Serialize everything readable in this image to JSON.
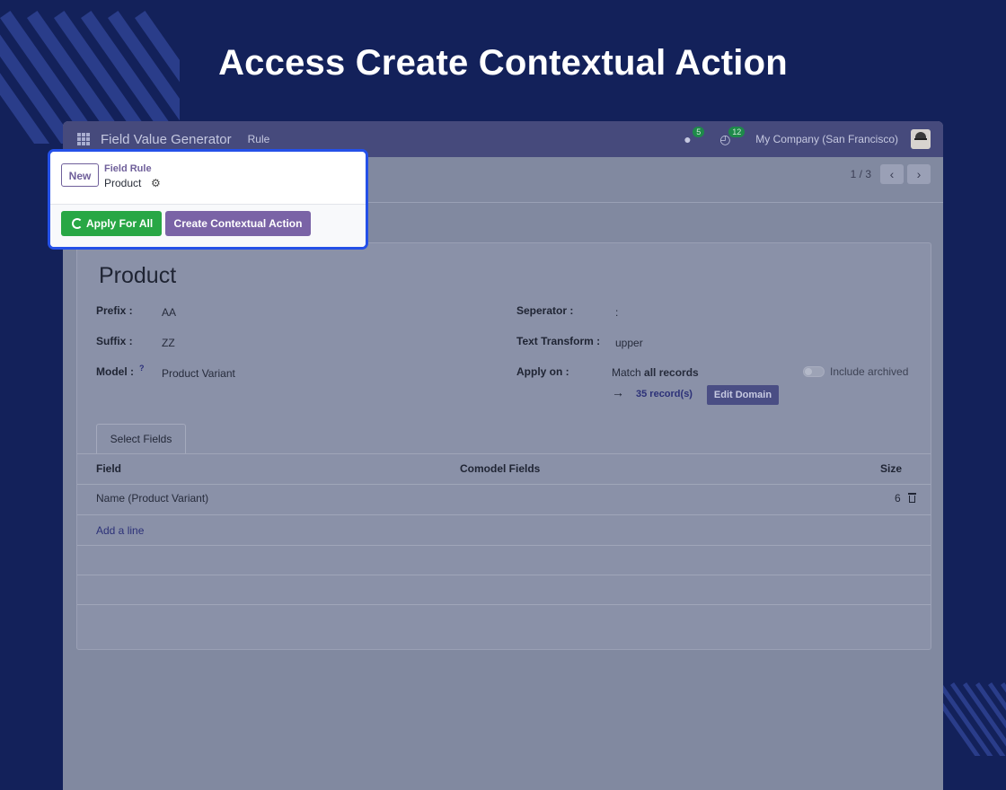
{
  "headline": "Access Create Contextual Action",
  "navbar": {
    "app_name": "Field Value Generator",
    "menu_item": "Rule",
    "messages_badge": "5",
    "activities_badge": "12",
    "company": "My Company (San Francisco)"
  },
  "breadcrumb": {
    "new_label": "New",
    "parent": "Field Rule",
    "current": "Product"
  },
  "actions": {
    "apply_label": "Apply For All",
    "contextual_label": "Create Contextual Action"
  },
  "pager": {
    "value": "1 / 3"
  },
  "form": {
    "title": "Product",
    "prefix_label": "Prefix :",
    "prefix_value": "AA",
    "suffix_label": "Suffix :",
    "suffix_value": "ZZ",
    "model_label": "Model :",
    "model_help": "?",
    "model_value": "Product Variant",
    "separator_label": "Seperator :",
    "separator_value": ":",
    "transform_label": "Text Transform :",
    "transform_value": "upper",
    "apply_on_label": "Apply on :",
    "apply_on_prefix": "Match",
    "apply_on_bold": "all records",
    "include_archived": "Include archived",
    "records_link": "35 record(s)",
    "edit_domain": "Edit Domain"
  },
  "tabs": {
    "select_fields": "Select Fields"
  },
  "table": {
    "headers": [
      "Field",
      "Comodel Fields",
      "Size"
    ],
    "rows": [
      {
        "field": "Name (Product Variant)",
        "comodel": "",
        "size": "6"
      }
    ],
    "add_line": "Add a line"
  },
  "colors": {
    "accent": "#7a63a6",
    "success": "#28a745",
    "highlight": "#2450e8",
    "background": "#13215a"
  }
}
